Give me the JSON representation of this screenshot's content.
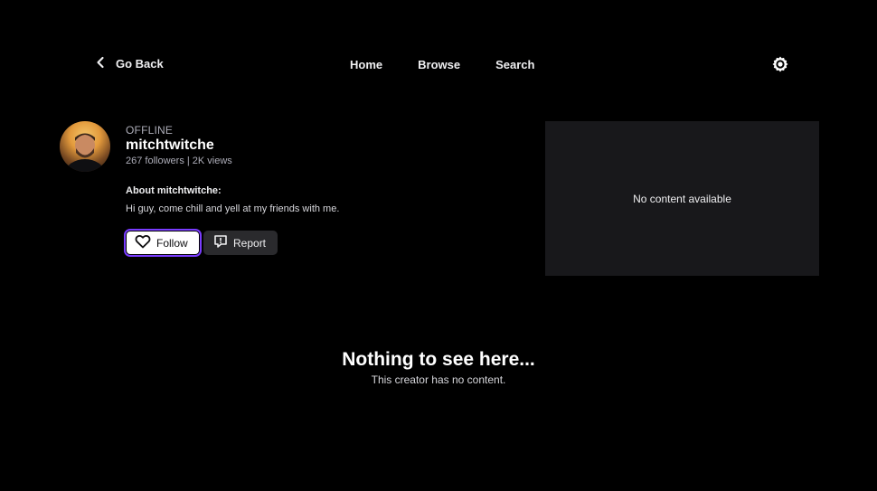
{
  "header": {
    "back_label": "Go Back",
    "nav": [
      {
        "label": "Home"
      },
      {
        "label": "Browse"
      },
      {
        "label": "Search"
      }
    ]
  },
  "profile": {
    "status": "OFFLINE",
    "username": "mitchtwitche",
    "stats": "267 followers | 2K views",
    "about_title": "About mitchtwitche:",
    "about_text": "Hi guy, come chill and yell at my friends with me.",
    "follow_label": "Follow",
    "report_label": "Report"
  },
  "panel": {
    "text": "No content available"
  },
  "empty_state": {
    "title": "Nothing to see here...",
    "subtitle": "This creator has no content."
  },
  "icons": {
    "back": "chevron-left-icon",
    "settings": "gear-icon",
    "follow": "heart-icon",
    "report": "report-flag-icon"
  },
  "colors": {
    "background": "#000000",
    "panel": "#18181b",
    "accent": "#7a3cff",
    "secondary_button": "#2a2a2d"
  }
}
